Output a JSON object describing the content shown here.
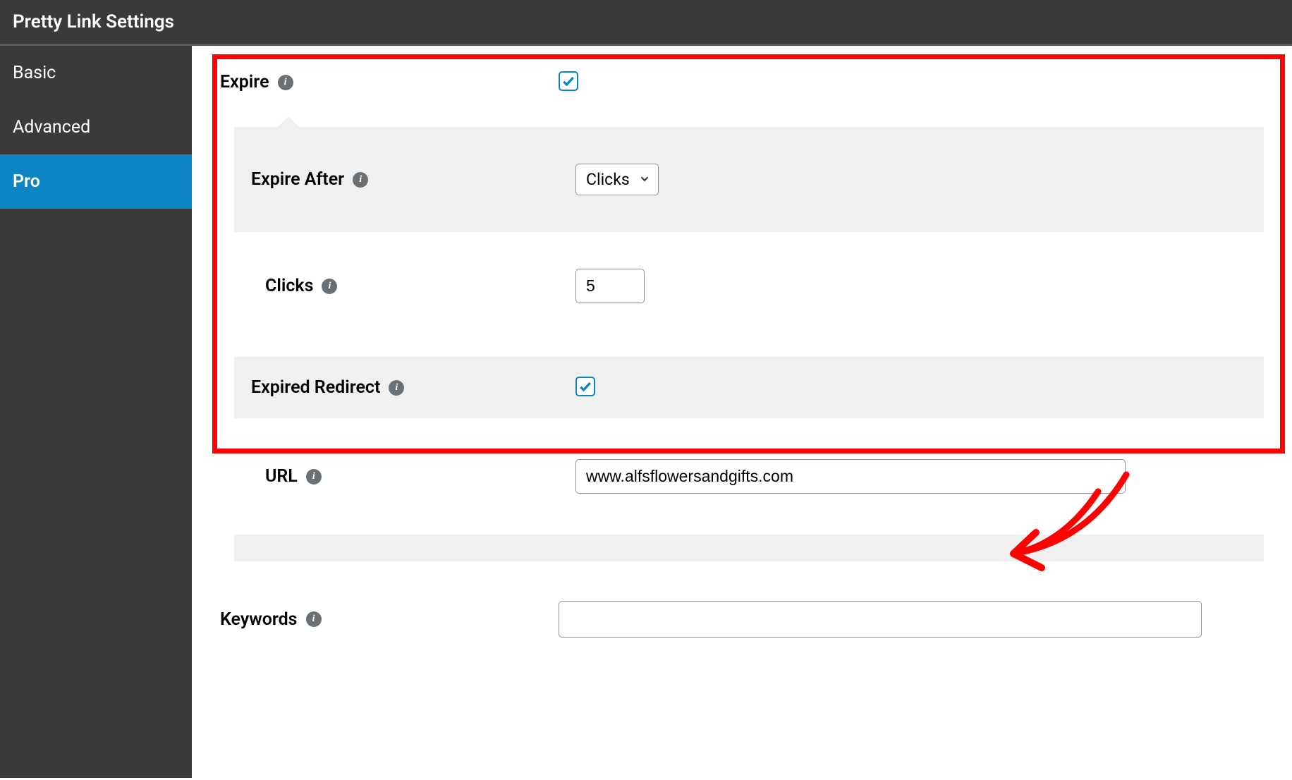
{
  "header": {
    "title": "Pretty Link Settings"
  },
  "sidebar": {
    "items": [
      {
        "label": "Basic",
        "active": false
      },
      {
        "label": "Advanced",
        "active": false
      },
      {
        "label": "Pro",
        "active": true
      }
    ]
  },
  "fields": {
    "expire": {
      "label": "Expire",
      "checked": true
    },
    "expire_after": {
      "label": "Expire After",
      "selected": "Clicks"
    },
    "clicks": {
      "label": "Clicks",
      "value": "5"
    },
    "expired_redirect": {
      "label": "Expired Redirect",
      "checked": true
    },
    "url": {
      "label": "URL",
      "value": "www.alfsflowersandgifts.com"
    },
    "keywords": {
      "label": "Keywords",
      "value": ""
    }
  }
}
